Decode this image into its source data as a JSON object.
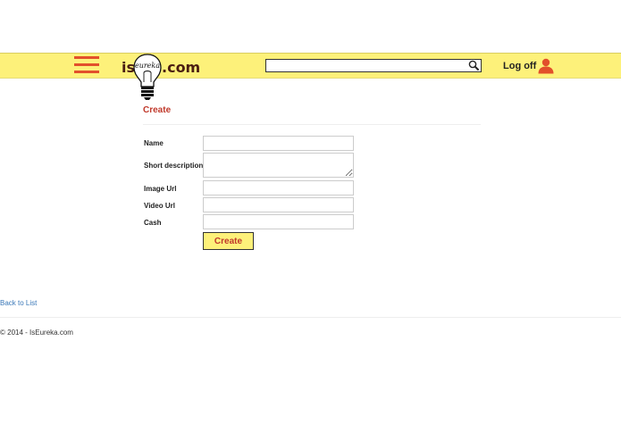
{
  "header": {
    "menu_icon": "hamburger-icon",
    "logo": {
      "prefix": "is",
      "script": "eureka",
      "suffix": ".com"
    },
    "search": {
      "value": "",
      "placeholder": "",
      "icon": "search-icon"
    },
    "logoff": {
      "label": "Log off",
      "icon": "user-icon"
    },
    "colors": {
      "bar": "#fdf17a",
      "accent": "#e2502b"
    }
  },
  "form": {
    "title": "Create",
    "fields": [
      {
        "label": "Name",
        "value": ""
      },
      {
        "label": "Short description",
        "value": ""
      },
      {
        "label": "Image Url",
        "value": ""
      },
      {
        "label": "Video Url",
        "value": ""
      },
      {
        "label": "Cash",
        "value": ""
      }
    ],
    "submit_label": "Create"
  },
  "nav": {
    "back_link": "Back to List"
  },
  "footer": {
    "text": "© 2014 - IsEureka.com"
  }
}
